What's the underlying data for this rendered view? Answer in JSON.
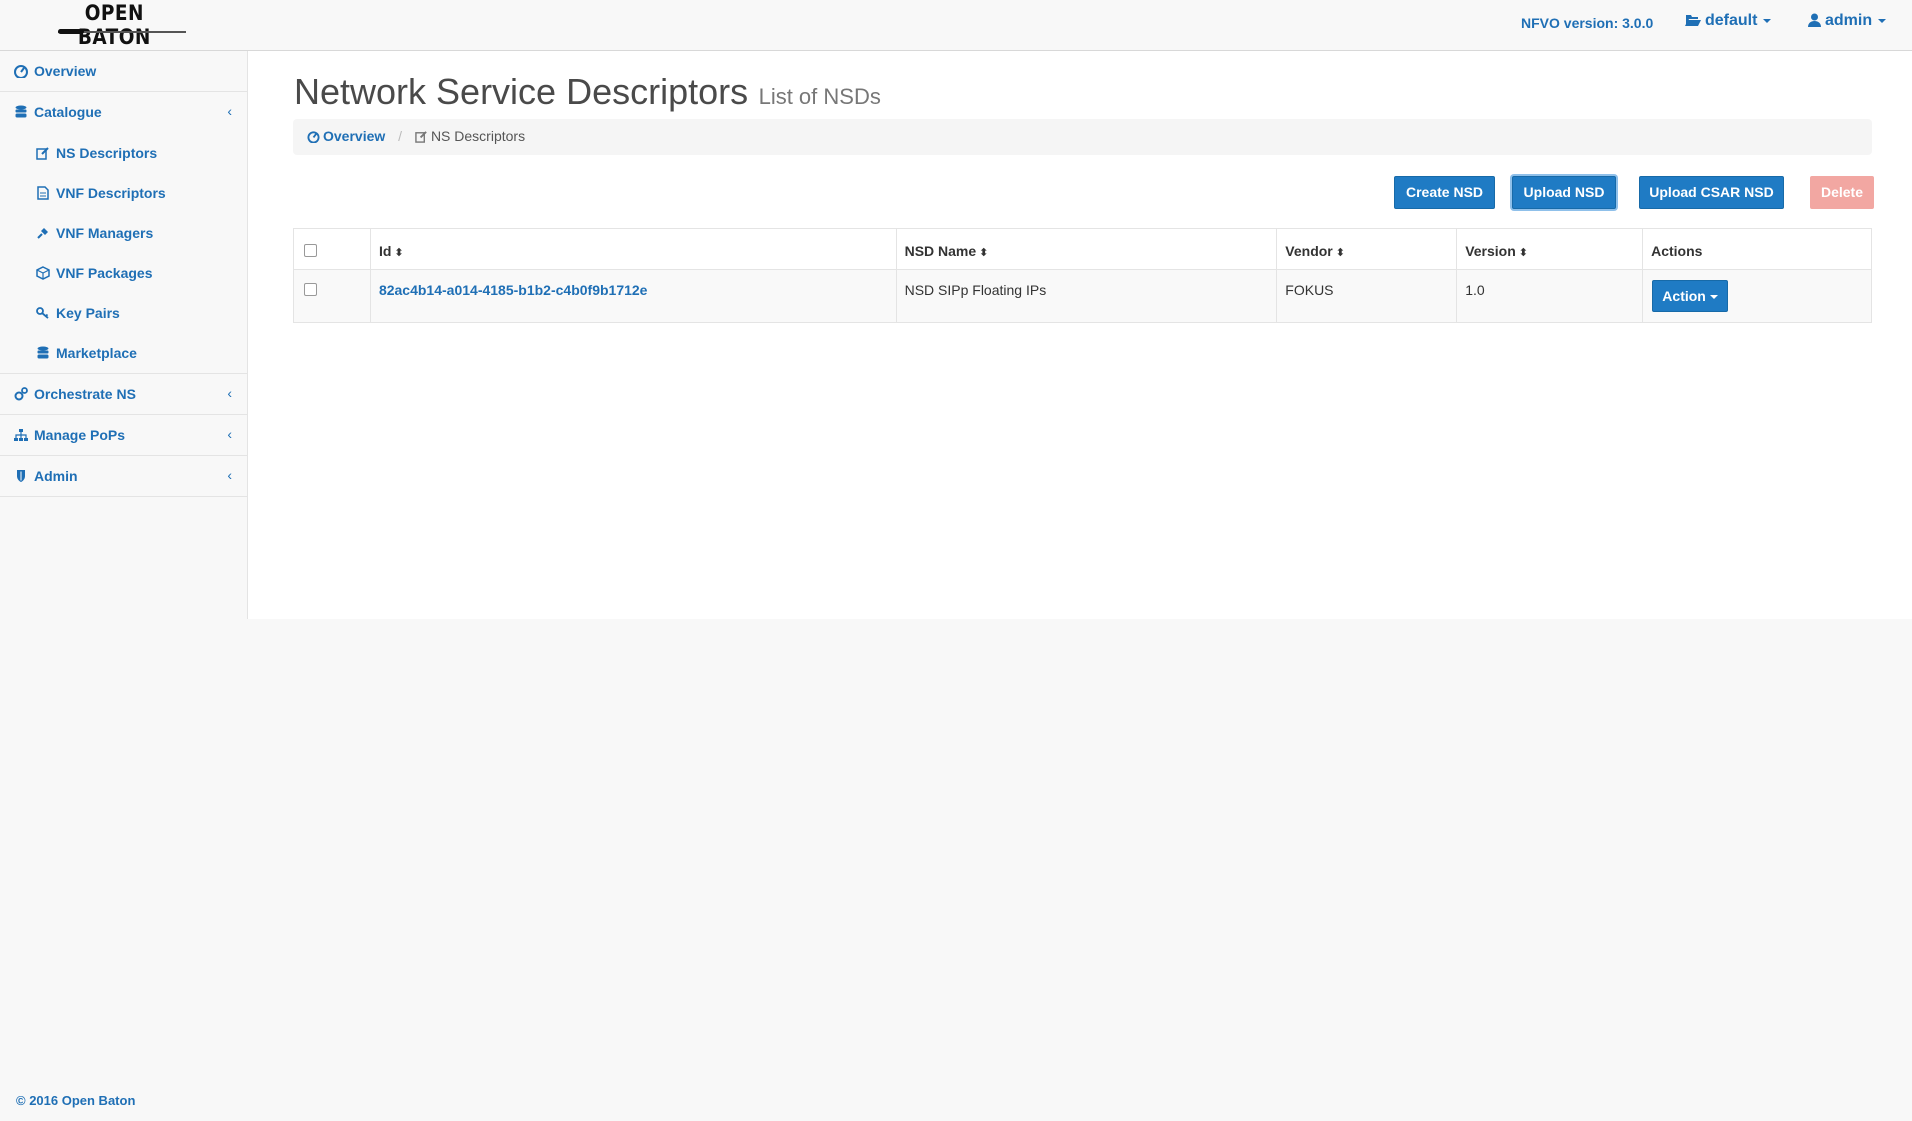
{
  "header": {
    "brand": "OPEN BATON",
    "version_label": "NFVO version: 3.0.0",
    "project": "default",
    "user": "admin"
  },
  "sidebar": {
    "items": [
      {
        "label": "Overview",
        "icon": "dashboard-icon"
      },
      {
        "label": "Catalogue",
        "icon": "database-icon"
      },
      {
        "label": "Orchestrate NS",
        "icon": "cogs-icon"
      },
      {
        "label": "Manage PoPs",
        "icon": "sitemap-icon"
      },
      {
        "label": "Admin",
        "icon": "shield-icon"
      }
    ],
    "catalogue_children": [
      {
        "label": "NS Descriptors",
        "icon": "edit-icon"
      },
      {
        "label": "VNF Descriptors",
        "icon": "file-icon"
      },
      {
        "label": "VNF Managers",
        "icon": "plug-icon"
      },
      {
        "label": "VNF Packages",
        "icon": "cube-icon"
      },
      {
        "label": "Key Pairs",
        "icon": "key-icon"
      },
      {
        "label": "Marketplace",
        "icon": "database-icon"
      }
    ]
  },
  "page": {
    "title": "Network Service Descriptors",
    "subtitle": "List of NSDs"
  },
  "breadcrumb": {
    "home": "Overview",
    "current": "NS Descriptors"
  },
  "toolbar": {
    "create": "Create NSD",
    "upload": "Upload NSD",
    "upload_csar": "Upload CSAR NSD",
    "delete": "Delete"
  },
  "table": {
    "columns": [
      "Id",
      "NSD Name",
      "Vendor",
      "Version",
      "Actions"
    ],
    "rows": [
      {
        "id": "82ac4b14-a014-4185-b1b2-c4b0f9b1712e",
        "name": "NSD SIPp Floating IPs",
        "vendor": "FOKUS",
        "version": "1.0",
        "action": "Action"
      }
    ]
  },
  "footer": {
    "copyright": "© 2016 Open Baton"
  },
  "colors": {
    "accent": "#1f7bc4",
    "link": "#1f6fb5",
    "delete": "#f2a7a2"
  }
}
